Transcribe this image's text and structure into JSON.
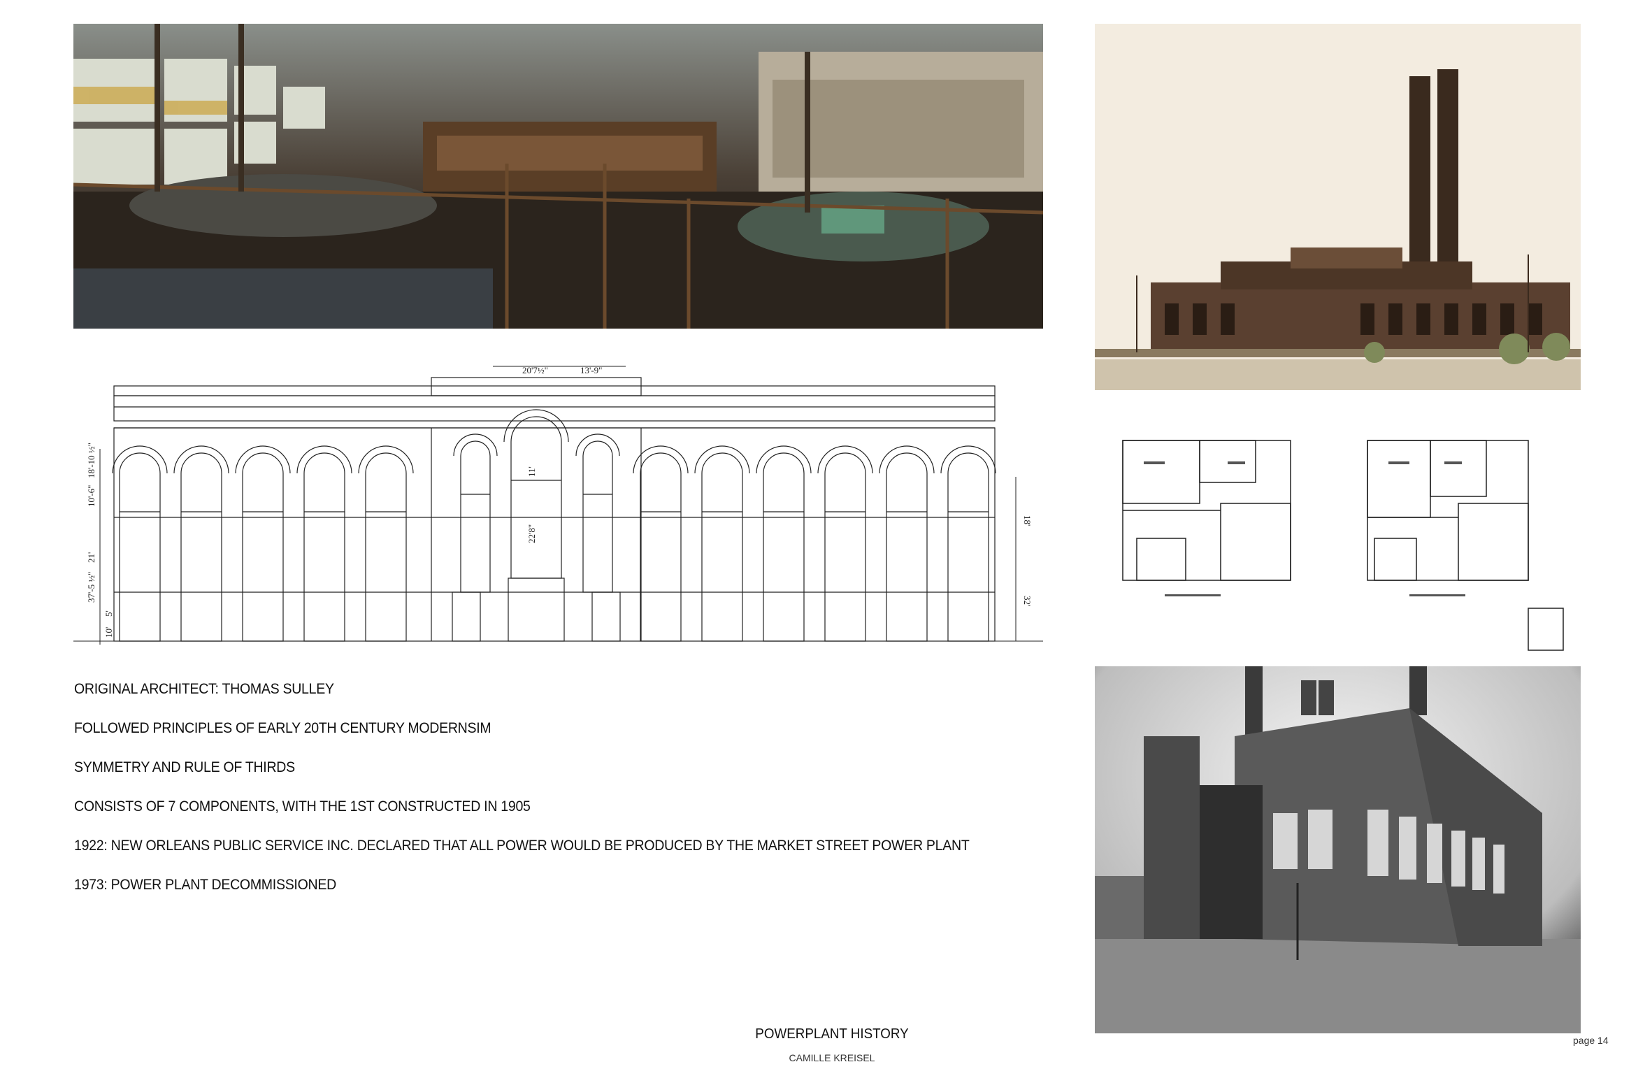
{
  "captions": [
    "ORIGINAL ARCHITECT: THOMAS SULLEY",
    "FOLLOWED PRINCIPLES OF EARLY 20TH CENTURY MODERNSIM",
    "SYMMETRY AND RULE OF THIRDS",
    "CONSISTS OF 7 COMPONENTS, WITH THE 1ST CONSTRUCTED IN 1905",
    "1922: NEW ORLEANS PUBLIC SERVICE INC. DECLARED THAT ALL POWER WOULD BE PRODUCED BY THE MARKET STREET POWER PLANT",
    "1973: POWER PLANT DECOMMISSIONED"
  ],
  "elevation": {
    "dims_top": [
      "20'7½\"",
      "13'-9\""
    ],
    "dims_left": [
      "18'-10 ½\"",
      "10'-6\"",
      "21'",
      "37'-5 ½\"",
      "5'",
      "10'"
    ],
    "dims_center": [
      "11'",
      "22'8\""
    ],
    "dims_right": [
      "18'",
      "32'"
    ]
  },
  "footer": {
    "title": "POWERPLANT HISTORY",
    "author": "CAMILLE KREISEL",
    "page": "page 14"
  }
}
